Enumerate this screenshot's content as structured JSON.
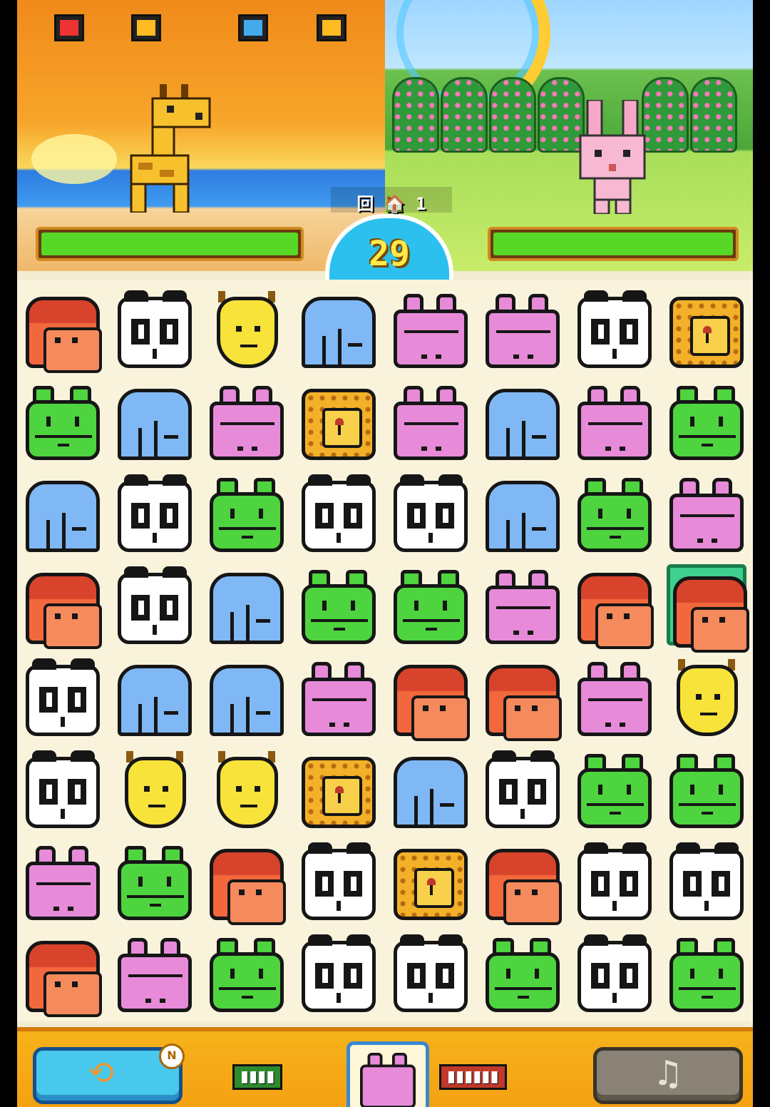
{
  "battle": {
    "timer": "29",
    "round_label": "回 🏠 1",
    "player_hp_fraction": 1.0,
    "enemy_hp_fraction": 1.0
  },
  "board": {
    "rows": [
      [
        "monkey",
        "panda",
        "giraffe",
        "elephant",
        "hippo",
        "hippo",
        "panda",
        "cookie"
      ],
      [
        "frog",
        "elephant",
        "hippo",
        "cookie",
        "hippo",
        "elephant",
        "hippo",
        "frog"
      ],
      [
        "elephant",
        "panda",
        "frog",
        "panda",
        "panda",
        "elephant",
        "frog",
        "hippo"
      ],
      [
        "monkey",
        "panda",
        "elephant",
        "frog",
        "frog",
        "hippo",
        "monkey",
        "monkey"
      ],
      [
        "panda",
        "elephant",
        "elephant",
        "hippo",
        "monkey",
        "monkey",
        "hippo",
        "giraffe"
      ],
      [
        "panda",
        "giraffe",
        "giraffe",
        "cookie",
        "elephant",
        "panda",
        "frog",
        "frog"
      ],
      [
        "hippo",
        "frog",
        "monkey",
        "panda",
        "cookie",
        "monkey",
        "panda",
        "panda"
      ],
      [
        "monkey",
        "hippo",
        "frog",
        "panda",
        "panda",
        "frog",
        "panda",
        "frog"
      ]
    ],
    "selected": {
      "row": 3,
      "col": 7
    }
  },
  "bottom": {
    "shuffle_badge": "N",
    "next_tile": "hippo",
    "sound_icon": "♫"
  },
  "colors": {
    "monkey": "#e5553a",
    "panda": "#ffffff",
    "giraffe": "#f8e33a",
    "elephant": "#7fb8f4",
    "hippo": "#e78ad8",
    "frog": "#4ed43e",
    "cookie": "#f3b12a"
  }
}
